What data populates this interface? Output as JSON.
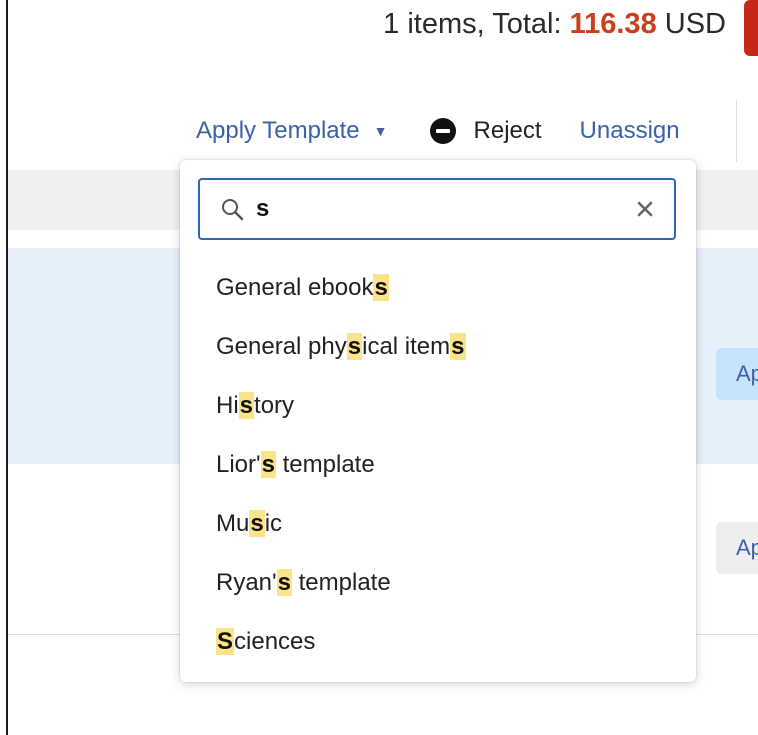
{
  "summary": {
    "prefix": "1 items, Total:",
    "amount": "116.38",
    "currency": "USD",
    "amount_color": "#c9401d"
  },
  "actions": {
    "apply_template": "Apply Template",
    "reject": "Reject",
    "unassign": "Unassign"
  },
  "side_buttons": {
    "row1": "Ap",
    "row2": "Ap"
  },
  "dropdown": {
    "search_value": "s",
    "options": [
      {
        "before": "General ebook",
        "match": "s",
        "after": ""
      },
      {
        "before": "General phy",
        "match": "s",
        "after": "ical item"
      },
      {
        "before": "Hi",
        "match": "s",
        "after": "tory"
      },
      {
        "before": "Lior'",
        "match": "s",
        "after": " template"
      },
      {
        "before": "Mu",
        "match": "s",
        "after": "ic"
      },
      {
        "before": "Ryan'",
        "match": "s",
        "after": " template"
      },
      {
        "before": "",
        "match": "S",
        "after": "ciences"
      }
    ]
  },
  "icons": {
    "search": "search-icon",
    "clear": "close-icon",
    "reject": "minus-circle-icon",
    "caret": "caret-down-icon"
  },
  "colors": {
    "accent": "#3a62a8",
    "highlight": "#fbe38a",
    "selected_row": "#e6f0fa",
    "danger": "#c62818"
  }
}
